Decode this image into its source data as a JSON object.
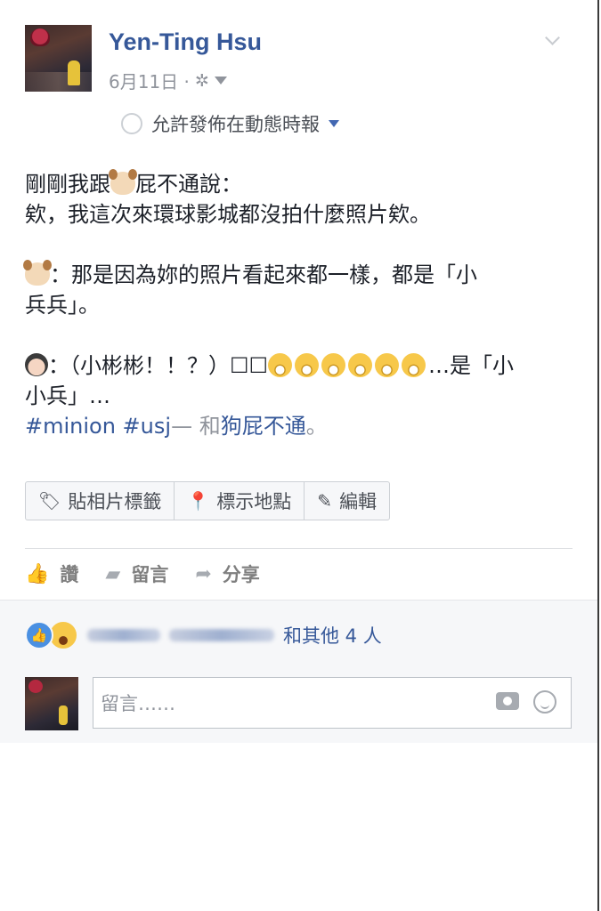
{
  "header": {
    "author": "Yen-Ting Hsu",
    "date": "6月11日 ·",
    "privacy_icon": "gear-icon",
    "allow_label": "允許發佈在動態時報"
  },
  "post": {
    "line1_a": "剛剛我跟",
    "line1_b": "屁不通說：",
    "line2": "欸，我這次來環球影城都沒拍什麼照片欸。",
    "line3": "：那是因為妳的照片看起來都一樣，都是「小",
    "line4": "兵兵」。",
    "line5_a": "：（小彬彬！！？）",
    "line5_box": "☐☐",
    "line5_b": "…是「小",
    "line6": "小兵」…",
    "hashtags": "#minion #usj",
    "dash": "— 和",
    "friend": "狗屁不通",
    "period": "。"
  },
  "actions": {
    "tag_photo": "貼相片標籤",
    "location": "標示地點",
    "edit": "編輯"
  },
  "feedback": {
    "like": "讚",
    "comment": "留言",
    "share": "分享"
  },
  "reactions": {
    "others": "和其他 4 人"
  },
  "comment_box": {
    "placeholder": "留言……"
  }
}
